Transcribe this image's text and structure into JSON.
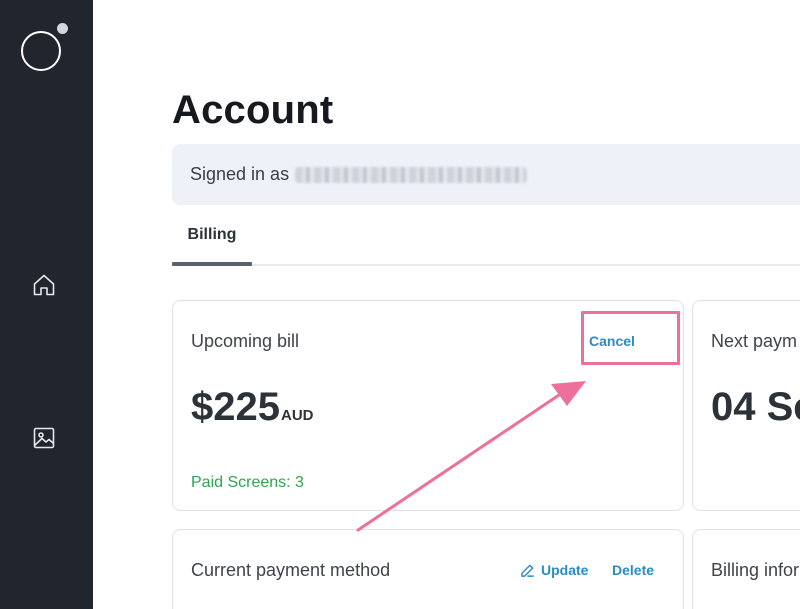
{
  "sidebar": {
    "logo": "app-logo",
    "items": [
      {
        "icon": "home-icon",
        "name": "Home"
      },
      {
        "icon": "image-icon",
        "name": "Media"
      }
    ]
  },
  "page": {
    "title": "Account",
    "signed_in_label": "Signed in as",
    "signed_in_email_redacted": true
  },
  "tabs": [
    {
      "label": "Billing",
      "active": true
    }
  ],
  "cards": {
    "upcoming_bill": {
      "title": "Upcoming bill",
      "amount": "$225",
      "currency": "AUD",
      "paid_screens": "Paid Screens: 3",
      "cancel_label": "Cancel"
    },
    "next_payment": {
      "title": "Next paym",
      "date": "04 Se"
    },
    "payment_method": {
      "title": "Current payment method",
      "update_label": "Update",
      "delete_label": "Delete"
    },
    "billing_info": {
      "title": "Billing infor"
    }
  },
  "annotation": {
    "color": "#ee6f9b",
    "target": "Cancel"
  },
  "colors": {
    "sidebar_bg": "#21252e",
    "accent": "#2a8bc5",
    "success": "#2ea44f",
    "signed_in_bg": "#eef1f8"
  }
}
